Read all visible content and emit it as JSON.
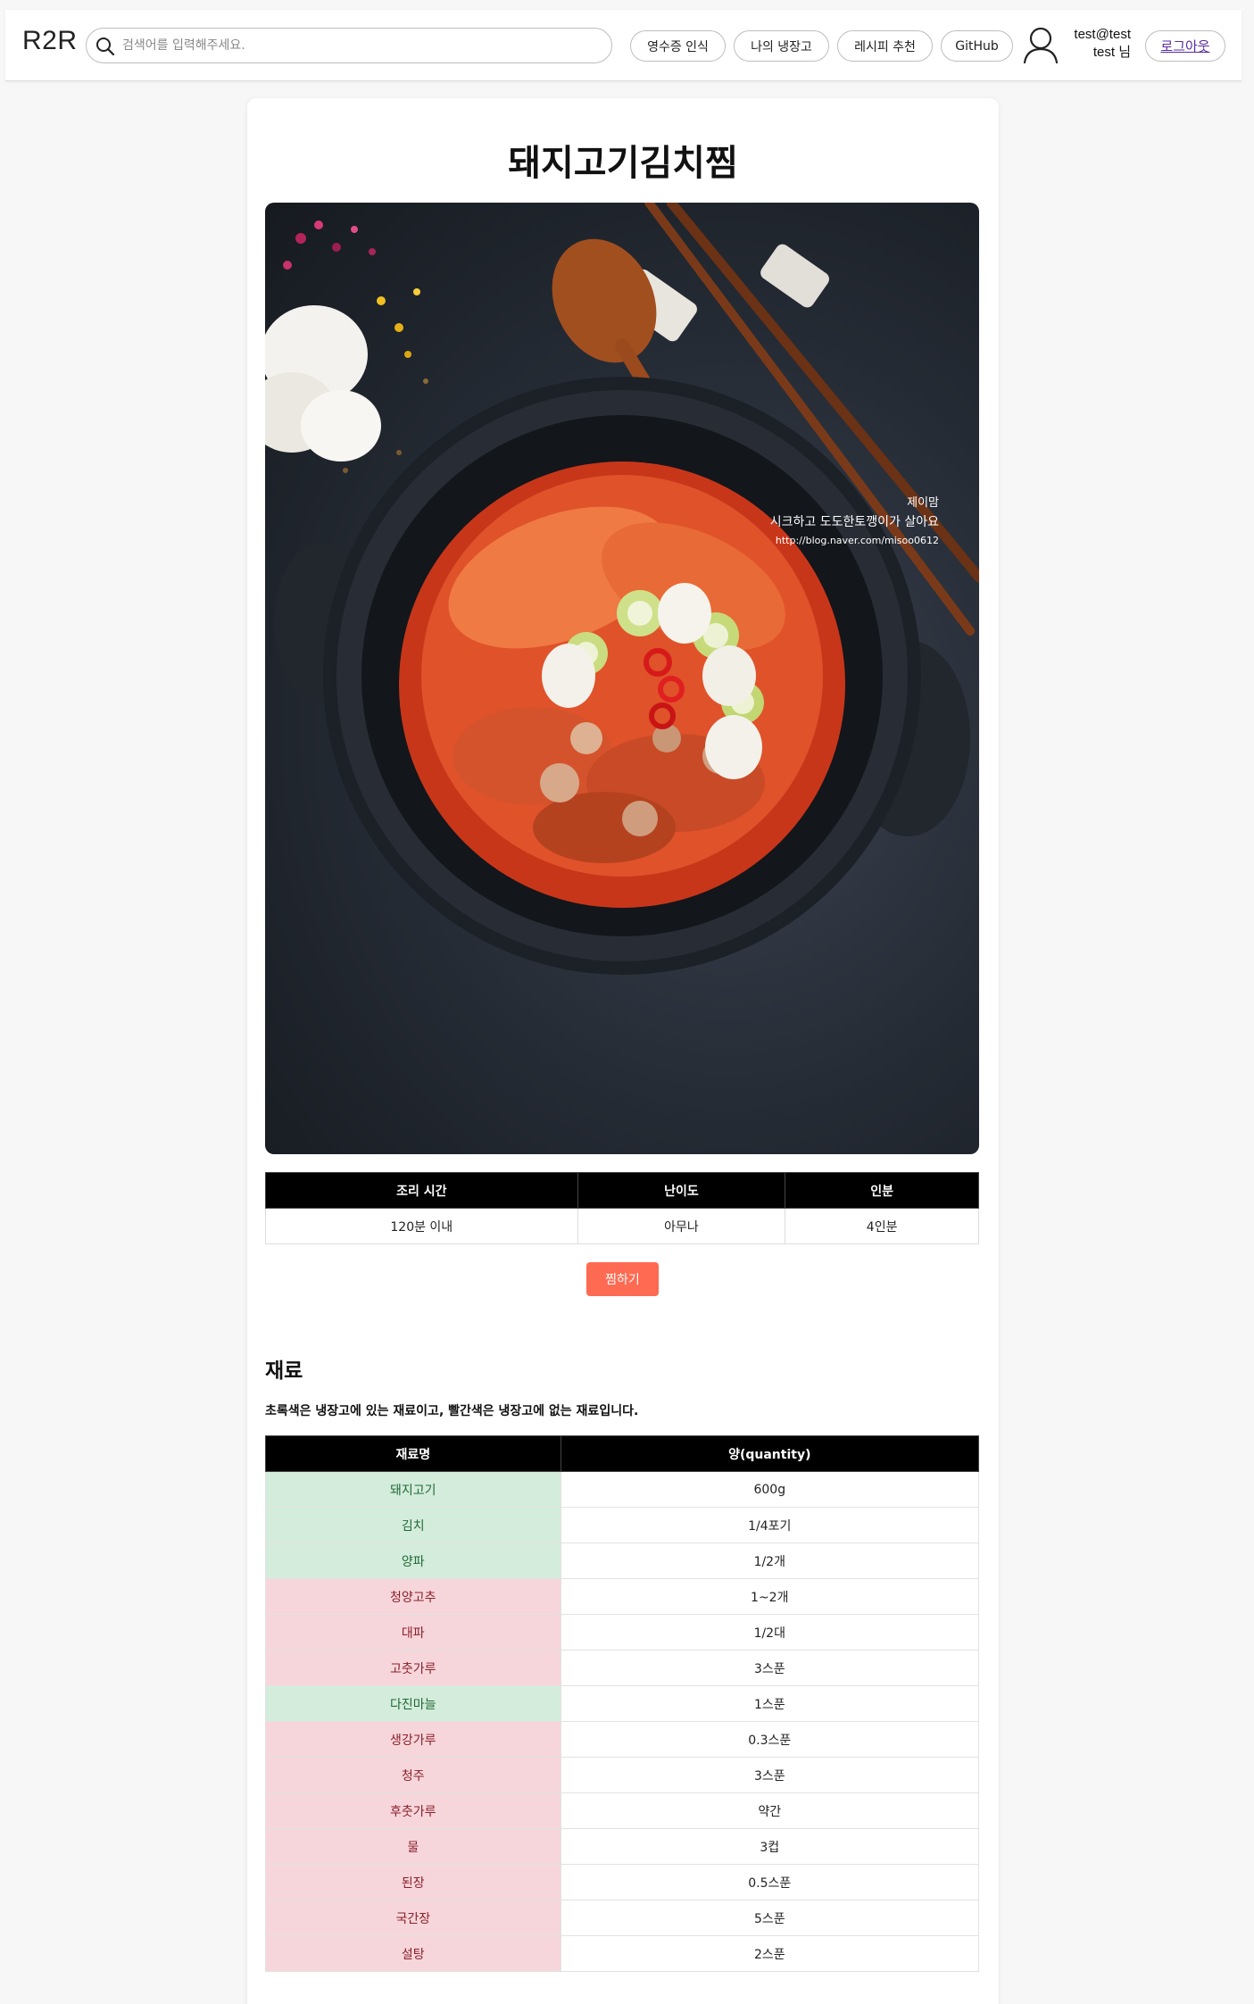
{
  "header": {
    "logo": "R2R",
    "search_placeholder": "검색어를 입력해주세요.",
    "nav": [
      "영수증 인식",
      "나의 냉장고",
      "레시피 추천",
      "GitHub"
    ],
    "user_email": "test@test",
    "user_greeting": "test 님",
    "logout_label": "로그아웃"
  },
  "recipe": {
    "title": "돼지고기김치찜",
    "watermark": {
      "line1": "제이맘",
      "line2": "시크하고 도도한토깽이가 살아요",
      "line3": "http://blog.naver.com/misoo0612"
    },
    "info_headers": [
      "조리 시간",
      "난이도",
      "인분"
    ],
    "info_values": [
      "120분 이내",
      "아무나",
      "4인분"
    ],
    "save_label": "찜하기"
  },
  "ingredients": {
    "section_title": "재료",
    "description": "초록색은 냉장고에 있는 재료이고, 빨간색은 냉장고에 없는 재료입니다.",
    "headers": [
      "재료명",
      "양(quantity)"
    ],
    "rows": [
      {
        "name": "돼지고기",
        "qty": "600g",
        "in_fridge": true
      },
      {
        "name": "김치",
        "qty": "1/4포기",
        "in_fridge": true
      },
      {
        "name": "양파",
        "qty": "1/2개",
        "in_fridge": true
      },
      {
        "name": "청양고추",
        "qty": "1~2개",
        "in_fridge": false
      },
      {
        "name": "대파",
        "qty": "1/2대",
        "in_fridge": false
      },
      {
        "name": "고춧가루",
        "qty": "3스푼",
        "in_fridge": false
      },
      {
        "name": "다진마늘",
        "qty": "1스푼",
        "in_fridge": true
      },
      {
        "name": "생강가루",
        "qty": "0.3스푼",
        "in_fridge": false
      },
      {
        "name": "청주",
        "qty": "3스푼",
        "in_fridge": false
      },
      {
        "name": "후춧가루",
        "qty": "약간",
        "in_fridge": false
      },
      {
        "name": "물",
        "qty": "3컵",
        "in_fridge": false
      },
      {
        "name": "된장",
        "qty": "0.5스푼",
        "in_fridge": false
      },
      {
        "name": "국간장",
        "qty": "5스푼",
        "in_fridge": false
      },
      {
        "name": "설탕",
        "qty": "2스푼",
        "in_fridge": false
      }
    ]
  },
  "colors": {
    "have_bg": "#d4ecdb",
    "missing_bg": "#f6d6da",
    "accent": "#ff6a52"
  }
}
